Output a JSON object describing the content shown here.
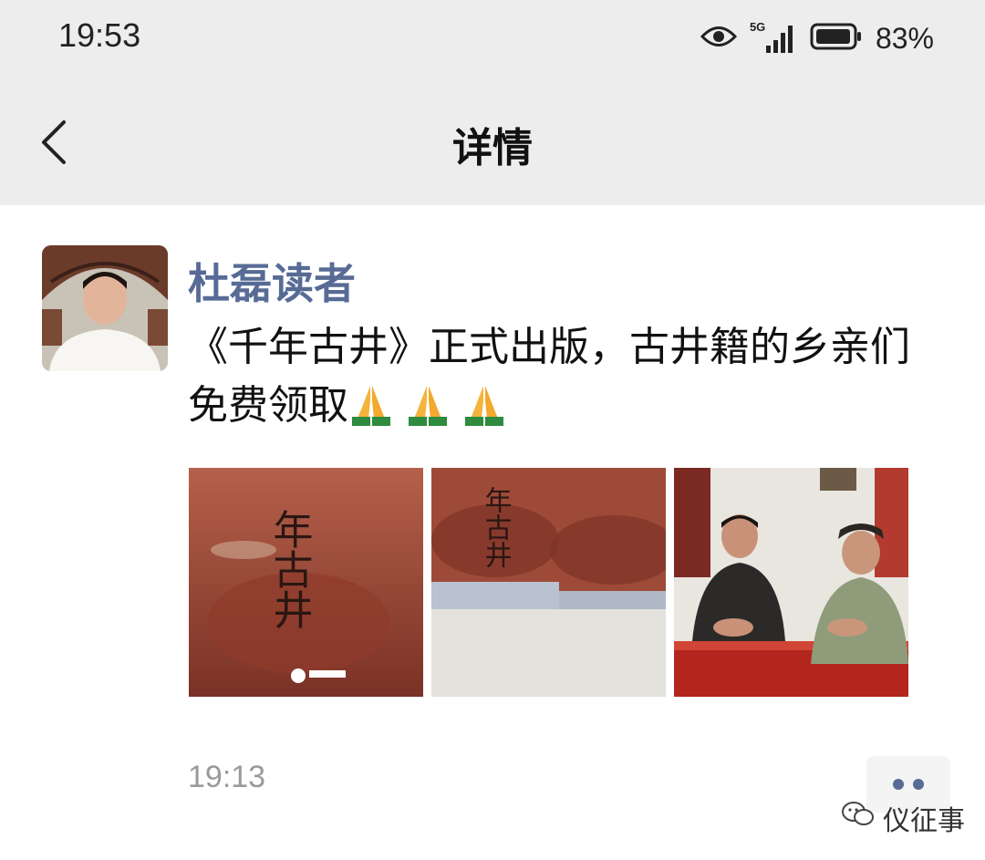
{
  "status_bar": {
    "time": "19:53",
    "network": "5G",
    "battery": "83%",
    "icons": [
      "eye-icon",
      "signal-icon",
      "battery-icon"
    ]
  },
  "nav": {
    "title": "详情",
    "back_icon": "chevron-left-icon"
  },
  "post": {
    "author": "杜磊读者",
    "text": "《千年古井》正式出版，古井籍的乡亲们免费领取",
    "emojis": [
      "folded-hands",
      "folded-hands",
      "folded-hands"
    ],
    "photos": [
      {
        "kind": "book-cover",
        "title_text": "年古井"
      },
      {
        "kind": "stacked-books",
        "title_text": "年古井"
      },
      {
        "kind": "two-men-at-table"
      }
    ],
    "time": "19:13",
    "more_icon": "ellipsis-icon"
  },
  "watermark": {
    "text": "仪征事",
    "icon": "wechat-bubble-icon"
  },
  "colors": {
    "bar_bg": "#ededed",
    "author": "#576b95",
    "time": "#9a9a9a"
  }
}
